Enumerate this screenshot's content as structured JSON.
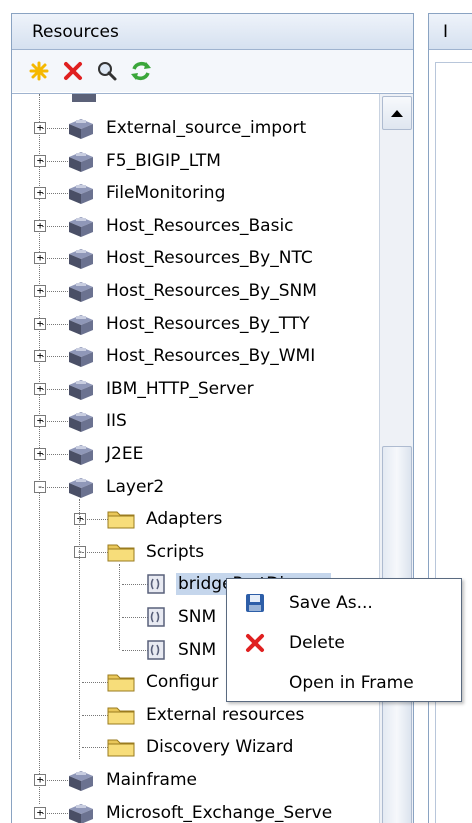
{
  "panel": {
    "title": "Resources",
    "toolbar": {
      "new_icon": "new-star-icon",
      "delete_icon": "delete-x-icon",
      "search_icon": "search-icon",
      "refresh_icon": "refresh-icon"
    }
  },
  "right_panel": {
    "title_fragment": "I"
  },
  "tree": {
    "items": [
      {
        "label": "External_source_import",
        "kind": "package",
        "expander": "+"
      },
      {
        "label": "F5_BIGIP_LTM",
        "kind": "package",
        "expander": "+"
      },
      {
        "label": "FileMonitoring",
        "kind": "package",
        "expander": "+"
      },
      {
        "label": "Host_Resources_Basic",
        "kind": "package",
        "expander": "+"
      },
      {
        "label": "Host_Resources_By_NTC",
        "kind": "package",
        "expander": "+"
      },
      {
        "label": "Host_Resources_By_SNM",
        "kind": "package",
        "expander": "+"
      },
      {
        "label": "Host_Resources_By_TTY",
        "kind": "package",
        "expander": "+"
      },
      {
        "label": "Host_Resources_By_WMI",
        "kind": "package",
        "expander": "+"
      },
      {
        "label": "IBM_HTTP_Server",
        "kind": "package",
        "expander": "+"
      },
      {
        "label": "IIS",
        "kind": "package",
        "expander": "+"
      },
      {
        "label": "J2EE",
        "kind": "package",
        "expander": "+"
      },
      {
        "label": "Layer2",
        "kind": "package",
        "expander": "-"
      },
      {
        "label": "Adapters",
        "kind": "folder",
        "expander": "+"
      },
      {
        "label": "Scripts",
        "kind": "folder",
        "expander": "-"
      },
      {
        "label": "bridgePortDisc.py",
        "kind": "script"
      },
      {
        "label": "SNM",
        "kind": "script"
      },
      {
        "label": "SNM",
        "kind": "script"
      },
      {
        "label": "Configur",
        "kind": "folder"
      },
      {
        "label": "External resources",
        "kind": "folder"
      },
      {
        "label": "Discovery Wizard",
        "kind": "folder"
      },
      {
        "label": "Mainframe",
        "kind": "package",
        "expander": "+"
      },
      {
        "label": "Microsoft_Exchange_Serve",
        "kind": "package",
        "expander": "+"
      }
    ]
  },
  "context_menu": {
    "items": [
      {
        "label": "Save As...",
        "icon": "save-disk-icon"
      },
      {
        "label": "Delete",
        "icon": "delete-x-icon"
      },
      {
        "label": "Open in Frame",
        "icon": ""
      }
    ]
  },
  "colors": {
    "header_bg": "#d6e1f0",
    "selection": "#c5d6ec",
    "delete_red": "#e02020",
    "new_star": "#f5b800",
    "refresh_green": "#3aa63a"
  }
}
